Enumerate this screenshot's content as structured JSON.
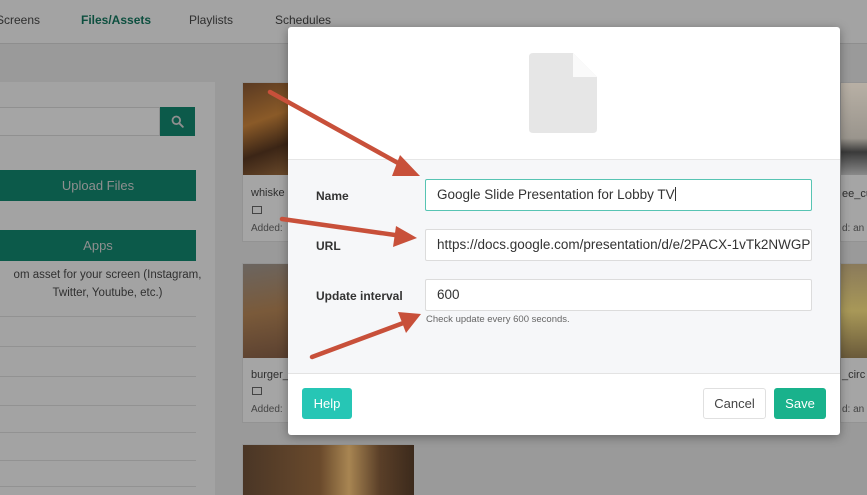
{
  "nav": {
    "items": [
      {
        "label": "Screens"
      },
      {
        "label": "Files/Assets"
      },
      {
        "label": "Playlists"
      },
      {
        "label": "Schedules"
      }
    ]
  },
  "sidebar": {
    "search_icon": "search-icon",
    "upload_label": "Upload Files",
    "apps_label": "Apps",
    "apps_description": "om asset for your screen (Instagram, Twitter, Youtube, etc.)"
  },
  "assets": [
    {
      "name": "whiske",
      "added": "Added: "
    },
    {
      "name": "ee_cu",
      "added": "d: an"
    },
    {
      "name": "burger_",
      "added": "Added: "
    },
    {
      "name": "_circ",
      "added": "d: an"
    }
  ],
  "modal": {
    "preview_icon": "document-icon",
    "name_label": "Name",
    "name_value": "Google Slide Presentation for Lobby TV",
    "url_label": "URL",
    "url_value": "https://docs.google.com/presentation/d/e/2PACX-1vTk2NWGP",
    "interval_label": "Update interval",
    "interval_value": "600",
    "interval_hint": "Check update every 600 seconds.",
    "help_label": "Help",
    "cancel_label": "Cancel",
    "save_label": "Save"
  },
  "colors": {
    "accent_teal": "#26c6b5",
    "save_green": "#19b28c",
    "annotation_arrow": "#c8503a"
  }
}
